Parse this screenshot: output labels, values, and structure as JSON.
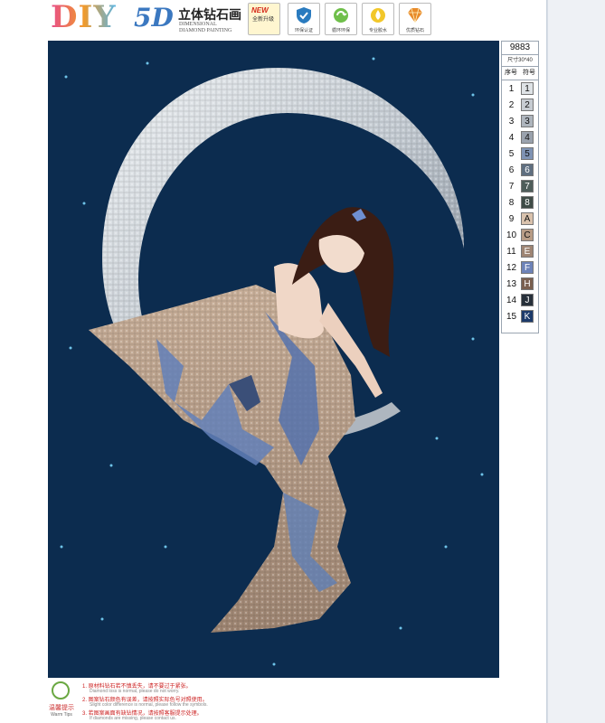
{
  "header": {
    "logo_diy": "DIY",
    "logo_5d": "5D",
    "title": "立体钻石画",
    "subtitle": "DIMENSIONAL DIAMOND PAINTING",
    "badges": [
      {
        "name": "new-badge",
        "text": "NEW",
        "sub": "全新升级"
      },
      {
        "name": "shield-badge",
        "caption": "环保认证"
      },
      {
        "name": "recycle-badge",
        "caption": "循环环保"
      },
      {
        "name": "drop-badge",
        "caption": "专业胶水"
      },
      {
        "name": "diamond-badge",
        "caption": "优质钻石"
      }
    ]
  },
  "legend": {
    "code": "9883",
    "size": "尺寸30*40",
    "col_index": "序号",
    "col_symbol": "符号",
    "rows": [
      {
        "num": "1",
        "sym": "1",
        "color": "#dfe3e6"
      },
      {
        "num": "2",
        "sym": "2",
        "color": "#c7ccd2"
      },
      {
        "num": "3",
        "sym": "3",
        "color": "#aeb5bd"
      },
      {
        "num": "4",
        "sym": "4",
        "color": "#9aa2ad"
      },
      {
        "num": "5",
        "sym": "5",
        "color": "#7f93b3"
      },
      {
        "num": "6",
        "sym": "6",
        "color": "#5f6f80"
      },
      {
        "num": "7",
        "sym": "7",
        "color": "#4e5d5a"
      },
      {
        "num": "8",
        "sym": "8",
        "color": "#3f4c47"
      },
      {
        "num": "9",
        "sym": "A",
        "color": "#d9c2ad"
      },
      {
        "num": "10",
        "sym": "C",
        "color": "#b79c86"
      },
      {
        "num": "11",
        "sym": "E",
        "color": "#9e8574"
      },
      {
        "num": "12",
        "sym": "F",
        "color": "#6d83b8"
      },
      {
        "num": "13",
        "sym": "H",
        "color": "#7a6050"
      },
      {
        "num": "14",
        "sym": "J",
        "color": "#27303a"
      },
      {
        "num": "15",
        "sym": "K",
        "color": "#1c3a6a"
      }
    ]
  },
  "footer": {
    "logo_caption": "温馨提示",
    "logo_sub": "Warm Tips",
    "tips": [
      "1. 原材料钻石若不慎丢失，请不要过于紧张。",
      "2. 图案钻石颜色有误差，请按照实际色号对照使用。",
      "3. 若图案画面有缺钻情况，请按照客服提示处理。"
    ],
    "tips_en": [
      "Diamond loss is normal, please do not worry.",
      "Slight color difference is normal, please follow the symbols.",
      "If diamonds are missing, please contact us."
    ]
  },
  "colors": {
    "background": "#0c2c4f",
    "moon_light": "#d7dde3",
    "moon_shadow": "#8e99a6",
    "dress": "#b89f88",
    "dress_blue": "#5f7fb7",
    "hair": "#3b1d14",
    "skin": "#f0d7c7"
  }
}
